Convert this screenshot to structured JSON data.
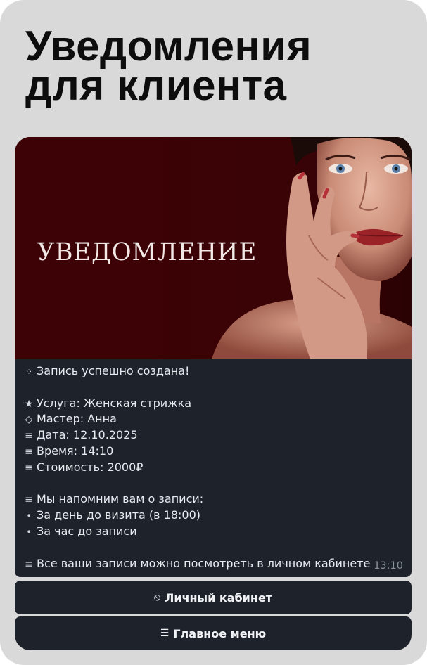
{
  "headline": {
    "line1": "Уведомления",
    "line2": "для клиента"
  },
  "banner": {
    "title": "УВЕДОМЛЕНИЕ",
    "colors": {
      "background": "#3a0306",
      "title": "#f2e9e6"
    }
  },
  "message": {
    "status": "Запись успешно создана!",
    "service": "Услуга: Женская стрижка",
    "master": "Мастер: Анна",
    "date": "Дата: 12.10.2025",
    "time_slot": "Время: 14:10",
    "price": "Стоимость: 2000₽",
    "reminder_title": "Мы напомним вам о записи:",
    "reminder_1": "За день до визита (в 18:00)",
    "reminder_2": "За час до записи",
    "cabinet_note": "Все ваши записи можно посмотреть в личном кабинете",
    "sent_time": "13:10",
    "icons": {
      "status": "sparkle-icon",
      "service": "star-icon",
      "master": "diamond-icon",
      "date": "menu-lines-icon",
      "time_slot": "menu-lines-icon",
      "price": "menu-lines-icon",
      "reminder_title": "menu-lines-icon",
      "reminder_items": "bullet-icon",
      "cabinet_note": "menu-lines-icon"
    }
  },
  "buttons": {
    "cabinet": {
      "icon": "no-entry-icon",
      "label": "Личный кабинет"
    },
    "main_menu": {
      "icon": "hamburger-icon",
      "label": "Главное меню"
    }
  },
  "colors": {
    "card": "#d9d9d9",
    "bubble": "#1e232b",
    "text": "#e7eaef",
    "time": "#8a929c"
  }
}
